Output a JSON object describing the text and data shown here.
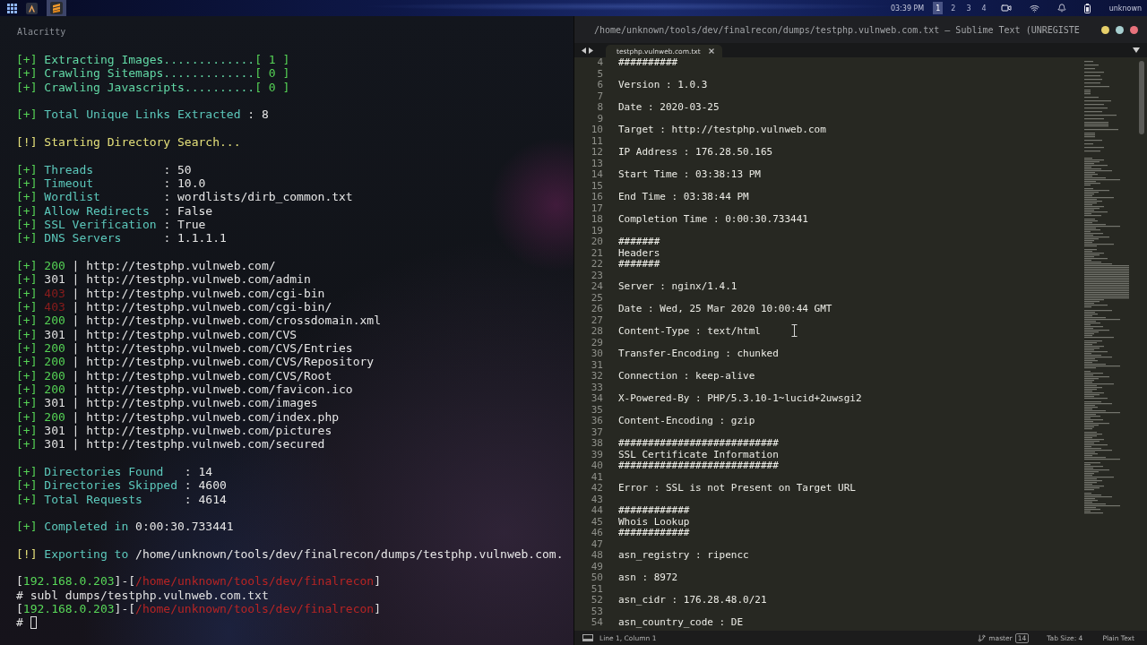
{
  "top_panel": {
    "apps": [
      {
        "selected": false
      },
      {
        "selected": true
      }
    ],
    "clock": "03:39 PM",
    "workspaces": [
      {
        "label": "1",
        "selected": true
      },
      {
        "label": "2",
        "selected": false
      },
      {
        "label": "3",
        "selected": false
      },
      {
        "label": "4",
        "selected": false
      }
    ],
    "user": "unknown"
  },
  "terminal": {
    "title": "Alacritty",
    "cursor": true,
    "blocks": [
      {
        "lines": [
          {
            "segments": [
              {
                "text": "[+] ",
                "kind": "ok"
              },
              {
                "text": "Extracting Images.............",
                "kind": "progress"
              },
              {
                "text": "[ 1 ]",
                "kind": "ok"
              }
            ]
          },
          {
            "segments": [
              {
                "text": "[+] ",
                "kind": "ok"
              },
              {
                "text": "Crawling Sitemaps.............",
                "kind": "progress"
              },
              {
                "text": "[ 0 ]",
                "kind": "ok"
              }
            ]
          },
          {
            "segments": [
              {
                "text": "[+] ",
                "kind": "ok"
              },
              {
                "text": "Crawling Javascripts..........",
                "kind": "progress"
              },
              {
                "text": "[ 0 ]",
                "kind": "ok"
              }
            ]
          }
        ]
      },
      {
        "lines": [
          {
            "segments": [
              {
                "text": "[+] ",
                "kind": "ok"
              },
              {
                "text": "Total Unique Links Extracted ",
                "kind": "label"
              },
              {
                "text": ": 8",
                "kind": "value"
              }
            ]
          }
        ]
      },
      {
        "lines": [
          {
            "segments": [
              {
                "text": "[!] ",
                "kind": "warn"
              },
              {
                "text": "Starting Directory Search...",
                "kind": "warn"
              }
            ]
          }
        ]
      },
      {
        "lines": [
          {
            "segments": [
              {
                "text": "[+] ",
                "kind": "ok"
              },
              {
                "text": "Threads          ",
                "kind": "label"
              },
              {
                "text": ": 50",
                "kind": "value"
              }
            ]
          },
          {
            "segments": [
              {
                "text": "[+] ",
                "kind": "ok"
              },
              {
                "text": "Timeout          ",
                "kind": "label"
              },
              {
                "text": ": 10.0",
                "kind": "value"
              }
            ]
          },
          {
            "segments": [
              {
                "text": "[+] ",
                "kind": "ok"
              },
              {
                "text": "Wordlist         ",
                "kind": "label"
              },
              {
                "text": ": wordlists/dirb_common.txt",
                "kind": "value"
              }
            ]
          },
          {
            "segments": [
              {
                "text": "[+] ",
                "kind": "ok"
              },
              {
                "text": "Allow Redirects  ",
                "kind": "label"
              },
              {
                "text": ": False",
                "kind": "value"
              }
            ]
          },
          {
            "segments": [
              {
                "text": "[+] ",
                "kind": "ok"
              },
              {
                "text": "SSL Verification ",
                "kind": "label"
              },
              {
                "text": ": True",
                "kind": "value"
              }
            ]
          },
          {
            "segments": [
              {
                "text": "[+] ",
                "kind": "ok"
              },
              {
                "text": "DNS Servers      ",
                "kind": "label"
              },
              {
                "text": ": 1.1.1.1",
                "kind": "value"
              }
            ]
          }
        ]
      },
      {
        "lines": [
          {
            "segments": [
              {
                "text": "[+] ",
                "kind": "ok"
              },
              {
                "text": "200",
                "kind": "ok"
              },
              {
                "text": " | http://testphp.vulnweb.com/",
                "kind": "value"
              }
            ]
          },
          {
            "segments": [
              {
                "text": "[+] ",
                "kind": "ok"
              },
              {
                "text": "301",
                "kind": "plain"
              },
              {
                "text": " | http://testphp.vulnweb.com/admin",
                "kind": "value"
              }
            ]
          },
          {
            "segments": [
              {
                "text": "[+] ",
                "kind": "ok"
              },
              {
                "text": "403",
                "kind": "error"
              },
              {
                "text": " | http://testphp.vulnweb.com/cgi-bin",
                "kind": "value"
              }
            ]
          },
          {
            "segments": [
              {
                "text": "[+] ",
                "kind": "ok"
              },
              {
                "text": "403",
                "kind": "error"
              },
              {
                "text": " | http://testphp.vulnweb.com/cgi-bin/",
                "kind": "value"
              }
            ]
          },
          {
            "segments": [
              {
                "text": "[+] ",
                "kind": "ok"
              },
              {
                "text": "200",
                "kind": "ok"
              },
              {
                "text": " | http://testphp.vulnweb.com/crossdomain.xml",
                "kind": "value"
              }
            ]
          },
          {
            "segments": [
              {
                "text": "[+] ",
                "kind": "ok"
              },
              {
                "text": "301",
                "kind": "plain"
              },
              {
                "text": " | http://testphp.vulnweb.com/CVS",
                "kind": "value"
              }
            ]
          },
          {
            "segments": [
              {
                "text": "[+] ",
                "kind": "ok"
              },
              {
                "text": "200",
                "kind": "ok"
              },
              {
                "text": " | http://testphp.vulnweb.com/CVS/Entries",
                "kind": "value"
              }
            ]
          },
          {
            "segments": [
              {
                "text": "[+] ",
                "kind": "ok"
              },
              {
                "text": "200",
                "kind": "ok"
              },
              {
                "text": " | http://testphp.vulnweb.com/CVS/Repository",
                "kind": "value"
              }
            ]
          },
          {
            "segments": [
              {
                "text": "[+] ",
                "kind": "ok"
              },
              {
                "text": "200",
                "kind": "ok"
              },
              {
                "text": " | http://testphp.vulnweb.com/CVS/Root",
                "kind": "value"
              }
            ]
          },
          {
            "segments": [
              {
                "text": "[+] ",
                "kind": "ok"
              },
              {
                "text": "200",
                "kind": "ok"
              },
              {
                "text": " | http://testphp.vulnweb.com/favicon.ico",
                "kind": "value"
              }
            ]
          },
          {
            "segments": [
              {
                "text": "[+] ",
                "kind": "ok"
              },
              {
                "text": "301",
                "kind": "plain"
              },
              {
                "text": " | http://testphp.vulnweb.com/images",
                "kind": "value"
              }
            ]
          },
          {
            "segments": [
              {
                "text": "[+] ",
                "kind": "ok"
              },
              {
                "text": "200",
                "kind": "ok"
              },
              {
                "text": " | http://testphp.vulnweb.com/index.php",
                "kind": "value"
              }
            ]
          },
          {
            "segments": [
              {
                "text": "[+] ",
                "kind": "ok"
              },
              {
                "text": "301",
                "kind": "plain"
              },
              {
                "text": " | http://testphp.vulnweb.com/pictures",
                "kind": "value"
              }
            ]
          },
          {
            "segments": [
              {
                "text": "[+] ",
                "kind": "ok"
              },
              {
                "text": "301",
                "kind": "plain"
              },
              {
                "text": " | http://testphp.vulnweb.com/secured",
                "kind": "value"
              }
            ]
          }
        ]
      },
      {
        "lines": [
          {
            "segments": [
              {
                "text": "[+] ",
                "kind": "ok"
              },
              {
                "text": "Directories Found   ",
                "kind": "label"
              },
              {
                "text": ": 14",
                "kind": "value"
              }
            ]
          },
          {
            "segments": [
              {
                "text": "[+] ",
                "kind": "ok"
              },
              {
                "text": "Directories Skipped ",
                "kind": "label"
              },
              {
                "text": ": 4600",
                "kind": "value"
              }
            ]
          },
          {
            "segments": [
              {
                "text": "[+] ",
                "kind": "ok"
              },
              {
                "text": "Total Requests      ",
                "kind": "label"
              },
              {
                "text": ": 4614",
                "kind": "value"
              }
            ]
          }
        ]
      },
      {
        "lines": [
          {
            "segments": [
              {
                "text": "[+] ",
                "kind": "ok"
              },
              {
                "text": "Completed in ",
                "kind": "label"
              },
              {
                "text": "0:00:30.733441",
                "kind": "value"
              }
            ]
          }
        ]
      },
      {
        "lines": [
          {
            "segments": [
              {
                "text": "[!] ",
                "kind": "warn"
              },
              {
                "text": "Exporting to ",
                "kind": "label"
              },
              {
                "text": "/home/unknown/tools/dev/finalrecon/dumps/testphp.vulnweb.com.",
                "kind": "value"
              }
            ]
          }
        ]
      },
      {
        "lines": [
          {
            "segments": [
              {
                "text": "[",
                "kind": "plain"
              },
              {
                "text": "192.168.0.203",
                "kind": "ip"
              },
              {
                "text": "]-[",
                "kind": "plain"
              },
              {
                "text": "/home/unknown/tools/dev/finalrecon",
                "kind": "path"
              },
              {
                "text": "]",
                "kind": "plain"
              }
            ]
          },
          {
            "segments": [
              {
                "text": "# subl dumps/testphp.vulnweb.com.txt",
                "kind": "plain"
              }
            ]
          },
          {
            "segments": [
              {
                "text": "[",
                "kind": "plain"
              },
              {
                "text": "192.168.0.203",
                "kind": "ip"
              },
              {
                "text": "]-[",
                "kind": "plain"
              },
              {
                "text": "/home/unknown/tools/dev/finalrecon",
                "kind": "path"
              },
              {
                "text": "]",
                "kind": "plain"
              }
            ]
          },
          {
            "segments": [
              {
                "text": "# ",
                "kind": "plain"
              }
            ]
          }
        ]
      }
    ]
  },
  "editor": {
    "title": "/home/unknown/tools/dev/finalrecon/dumps/testphp.vulnweb.com.txt – Sublime Text (UNREGISTE",
    "tabs": [
      {
        "label": "testphp.vulnweb.com.txt",
        "selected": true
      }
    ],
    "lines": [
      {
        "number": "4",
        "text": "##########"
      },
      {
        "number": "5"
      },
      {
        "number": "6",
        "text": "Version : 1.0.3"
      },
      {
        "number": "7"
      },
      {
        "number": "8",
        "text": "Date : 2020-03-25"
      },
      {
        "number": "9"
      },
      {
        "number": "10",
        "text": "Target : http://testphp.vulnweb.com"
      },
      {
        "number": "11"
      },
      {
        "number": "12",
        "text": "IP Address : 176.28.50.165"
      },
      {
        "number": "13"
      },
      {
        "number": "14",
        "text": "Start Time : 03:38:13 PM"
      },
      {
        "number": "15"
      },
      {
        "number": "16",
        "text": "End Time : 03:38:44 PM"
      },
      {
        "number": "17"
      },
      {
        "number": "18",
        "text": "Completion Time : 0:00:30.733441"
      },
      {
        "number": "19"
      },
      {
        "number": "20",
        "text": "#######"
      },
      {
        "number": "21",
        "text": "Headers"
      },
      {
        "number": "22",
        "text": "#######"
      },
      {
        "number": "23"
      },
      {
        "number": "24",
        "text": "Server : nginx/1.4.1"
      },
      {
        "number": "25"
      },
      {
        "number": "26",
        "text": "Date : Wed, 25 Mar 2020 10:00:44 GMT"
      },
      {
        "number": "27"
      },
      {
        "number": "28",
        "text": "Content-Type : text/html"
      },
      {
        "number": "29"
      },
      {
        "number": "30",
        "text": "Transfer-Encoding : chunked"
      },
      {
        "number": "31"
      },
      {
        "number": "32",
        "text": "Connection : keep-alive"
      },
      {
        "number": "33"
      },
      {
        "number": "34",
        "text": "X-Powered-By : PHP/5.3.10-1~lucid+2uwsgi2"
      },
      {
        "number": "35"
      },
      {
        "number": "36",
        "text": "Content-Encoding : gzip"
      },
      {
        "number": "37"
      },
      {
        "number": "38",
        "text": "###########################"
      },
      {
        "number": "39",
        "text": "SSL Certificate Information"
      },
      {
        "number": "40",
        "text": "###########################"
      },
      {
        "number": "41"
      },
      {
        "number": "42",
        "text": "Error : SSL is not Present on Target URL"
      },
      {
        "number": "43"
      },
      {
        "number": "44",
        "text": "############"
      },
      {
        "number": "45",
        "text": "Whois Lookup"
      },
      {
        "number": "46",
        "text": "############"
      },
      {
        "number": "47"
      },
      {
        "number": "48",
        "text": "asn_registry : ripencc"
      },
      {
        "number": "49"
      },
      {
        "number": "50",
        "text": "asn : 8972"
      },
      {
        "number": "51"
      },
      {
        "number": "52",
        "text": "asn_cidr : 176.28.48.0/21"
      },
      {
        "number": "53"
      },
      {
        "number": "54",
        "text": "asn_country_code : DE"
      }
    ],
    "status_bar": {
      "position": "Line 1, Column 1",
      "branch": "master",
      "changes": "14",
      "tab_size": "Tab Size: 4",
      "syntax": "Plain Text"
    }
  }
}
